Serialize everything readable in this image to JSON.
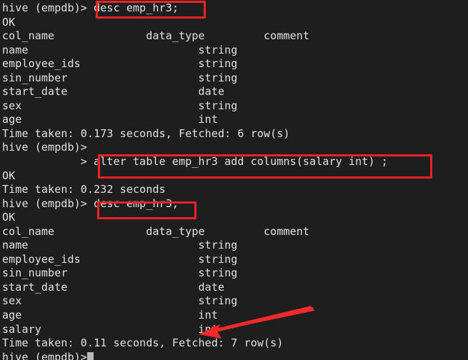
{
  "terminal": {
    "app": "Hive CLI",
    "prompt": "hive (empdb)>",
    "continuation_prompt": ">",
    "colors": {
      "background": "#1e1e1e",
      "foreground": "#e2e2e2",
      "annotation": "#ef2323"
    },
    "lines": [
      {
        "id": "l01",
        "text": "hive (empdb)> desc emp_hr3;"
      },
      {
        "id": "l02",
        "text": "OK"
      },
      {
        "id": "l03",
        "text": "col_name              data_type         comment"
      },
      {
        "id": "l04",
        "text": "name                          string"
      },
      {
        "id": "l05",
        "text": "employee_ids                  string"
      },
      {
        "id": "l06",
        "text": "sin_number                    string"
      },
      {
        "id": "l07",
        "text": "start_date                    date"
      },
      {
        "id": "l08",
        "text": "sex                           string"
      },
      {
        "id": "l09",
        "text": "age                           int"
      },
      {
        "id": "l10",
        "text": "Time taken: 0.173 seconds, Fetched: 6 row(s)"
      },
      {
        "id": "l11",
        "text": "hive (empdb)>"
      },
      {
        "id": "l12",
        "text": "            > alter table emp_hr3 add columns(salary int) ;"
      },
      {
        "id": "l13",
        "text": "OK"
      },
      {
        "id": "l14",
        "text": "Time taken: 0.232 seconds"
      },
      {
        "id": "l15",
        "text": "hive (empdb)> desc emp_hr3;"
      },
      {
        "id": "l16",
        "text": "OK"
      },
      {
        "id": "l17",
        "text": "col_name              data_type         comment"
      },
      {
        "id": "l18",
        "text": "name                          string"
      },
      {
        "id": "l19",
        "text": "employee_ids                  string"
      },
      {
        "id": "l20",
        "text": "sin_number                    string"
      },
      {
        "id": "l21",
        "text": "start_date                    date"
      },
      {
        "id": "l22",
        "text": "sex                           string"
      },
      {
        "id": "l23",
        "text": "age                           int"
      },
      {
        "id": "l24",
        "text": "salary                        int"
      },
      {
        "id": "l25",
        "text": "Time taken: 0.11 seconds, Fetched: 7 row(s)"
      }
    ],
    "final_prompt": "hive (empdb)>",
    "commands": {
      "first_desc": "desc emp_hr3;",
      "alter_table": "alter table emp_hr3 add columns(salary int) ;",
      "second_desc": "desc emp_hr3;"
    },
    "schema_before": {
      "headers": [
        "col_name",
        "data_type",
        "comment"
      ],
      "rows": [
        [
          "name",
          "string",
          ""
        ],
        [
          "employee_ids",
          "string",
          ""
        ],
        [
          "sin_number",
          "string",
          ""
        ],
        [
          "start_date",
          "date",
          ""
        ],
        [
          "sex",
          "string",
          ""
        ],
        [
          "age",
          "int",
          ""
        ]
      ],
      "fetched": "6 row(s)",
      "time_taken": "0.173 seconds"
    },
    "schema_after": {
      "headers": [
        "col_name",
        "data_type",
        "comment"
      ],
      "rows": [
        [
          "name",
          "string",
          ""
        ],
        [
          "employee_ids",
          "string",
          ""
        ],
        [
          "sin_number",
          "string",
          ""
        ],
        [
          "start_date",
          "date",
          ""
        ],
        [
          "sex",
          "string",
          ""
        ],
        [
          "age",
          "int",
          ""
        ],
        [
          "salary",
          "int",
          ""
        ]
      ],
      "fetched": "7 row(s)",
      "time_taken": "0.11 seconds"
    },
    "annotations": {
      "box_first_desc": {
        "label": "desc emp_hr3;"
      },
      "box_alter": {
        "label": "alter table emp_hr3 add columns(salary int) ;"
      },
      "box_second_desc": {
        "label": "desc emp_hr3;"
      },
      "arrow_salary": {
        "label": "points to salary int"
      }
    }
  }
}
